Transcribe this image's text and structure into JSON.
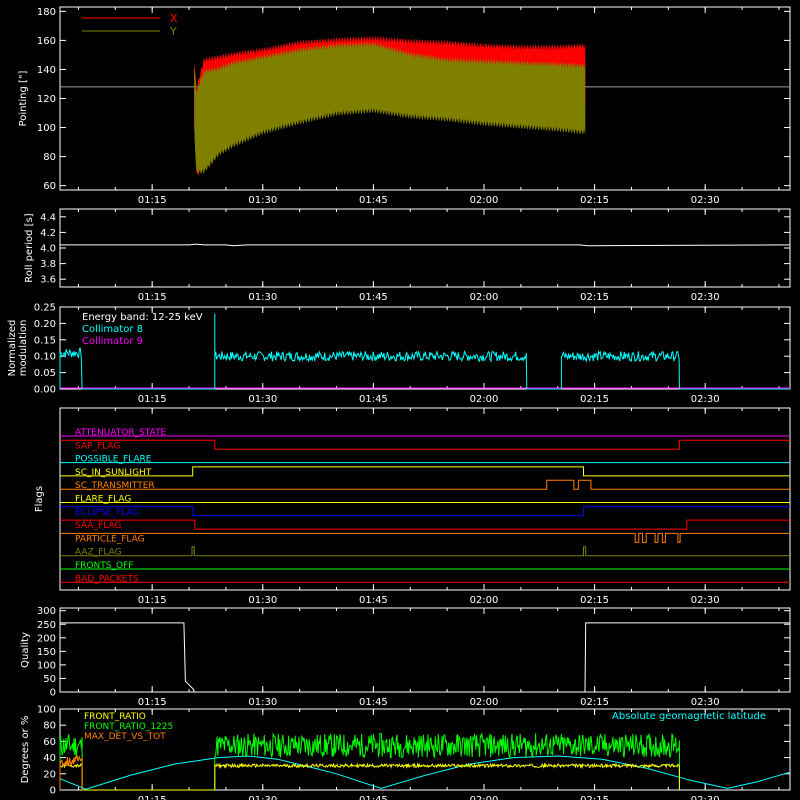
{
  "colors": {
    "background": "#000000",
    "axis": "#ffffff",
    "red": "#ff0000",
    "olive": "#808000",
    "cyan": "#00ffff",
    "magenta": "#ff00ff",
    "yellow": "#ffff00",
    "orange": "#ff8000",
    "blue": "#0000ff",
    "green": "#00ff00",
    "white": "#ffffff"
  },
  "time_axis": {
    "range_minutes": [
      62.5,
      161.5
    ],
    "ticks": [
      {
        "minute": 75,
        "label": "01:15"
      },
      {
        "minute": 90,
        "label": "01:30"
      },
      {
        "minute": 105,
        "label": "01:45"
      },
      {
        "minute": 120,
        "label": "02:00"
      },
      {
        "minute": 135,
        "label": "02:15"
      },
      {
        "minute": 150,
        "label": "02:30"
      }
    ]
  },
  "chart_data": [
    {
      "id": "pointing",
      "type": "line",
      "ylabel": "Pointing [\"]",
      "ylim": [
        57,
        183
      ],
      "yticks": [
        60,
        80,
        100,
        120,
        140,
        160,
        180
      ],
      "legend": [
        {
          "label": "X",
          "color": "#ff0000"
        },
        {
          "label": "Y",
          "color": "#808000"
        }
      ],
      "reference_level": 128,
      "data_span_minutes": [
        80.7,
        133.8
      ],
      "series": [
        {
          "name": "X",
          "color": "#ff0000",
          "x": [
            80.7,
            81,
            82,
            84,
            86,
            90,
            95,
            100,
            105,
            110,
            115,
            120,
            125,
            130,
            133.8
          ],
          "upper": [
            148,
            128,
            148,
            150,
            152,
            155,
            160,
            162,
            163,
            161,
            160,
            158,
            157,
            157,
            158
          ],
          "lower": [
            100,
            66,
            70,
            84,
            92,
            102,
            110,
            118,
            116,
            118,
            117,
            116,
            115,
            114,
            113
          ]
        },
        {
          "name": "Y",
          "color": "#808000",
          "x": [
            80.7,
            81,
            82,
            84,
            86,
            90,
            95,
            100,
            105,
            110,
            115,
            120,
            125,
            130,
            133.8
          ],
          "upper": [
            146,
            126,
            140,
            142,
            146,
            150,
            155,
            158,
            159,
            152,
            148,
            147,
            146,
            145,
            144
          ],
          "lower": [
            96,
            68,
            68,
            80,
            86,
            95,
            102,
            108,
            110,
            106,
            104,
            101,
            99,
            97,
            95
          ]
        }
      ]
    },
    {
      "id": "roll_period",
      "type": "line",
      "ylabel": "Roll period [s]",
      "ylim": [
        3.5,
        4.5
      ],
      "yticks": [
        3.6,
        3.8,
        4.0,
        4.2,
        4.4
      ],
      "yticklabels": [
        "3.6",
        "3.8",
        "4.0",
        "4.2",
        "4.4"
      ],
      "series": [
        {
          "name": "",
          "color": "#ffffff",
          "x": [
            62.5,
            80,
            81,
            82,
            85,
            86,
            88,
            133,
            134,
            161.5
          ],
          "y": [
            4.04,
            4.04,
            4.05,
            4.04,
            4.04,
            4.03,
            4.04,
            4.04,
            4.03,
            4.04
          ]
        }
      ]
    },
    {
      "id": "modulation",
      "type": "line",
      "ylabel": "Normalized modulation",
      "ylabel_lines": [
        "Normalized",
        "modulation"
      ],
      "ylim": [
        0,
        0.25
      ],
      "yticks": [
        0,
        0.05,
        0.1,
        0.15,
        0.2,
        0.25
      ],
      "yticklabels": [
        "0.00",
        "0.05",
        "0.10",
        "0.15",
        "0.20",
        "0.25"
      ],
      "legend": [
        {
          "label": "Energy band: 12-25 keV",
          "color": "#ffffff"
        },
        {
          "label": "Collimator 8",
          "color": "#00ffff"
        },
        {
          "label": "Collimator 9",
          "color": "#ff00ff"
        }
      ],
      "series": [
        {
          "name": "Collimator 8",
          "color": "#00ffff",
          "segments": [
            {
              "x0": 62.5,
              "x1": 65.5,
              "level": 0.11
            },
            {
              "x0": 83.5,
              "x1": 125.8,
              "level": 0.1,
              "spike_at_start": 0.23
            },
            {
              "x0": 130.5,
              "x1": 146.5,
              "level": 0.1
            }
          ],
          "baseline": 0.0
        },
        {
          "name": "Collimator 9",
          "color": "#ff00ff",
          "x": [
            62.5,
            161.5
          ],
          "y": [
            0,
            0
          ]
        }
      ]
    },
    {
      "id": "flags",
      "type": "line",
      "ylabel": "Flags",
      "rows": [
        {
          "label": "ATTENUATOR_STATE",
          "color": "#ff00ff",
          "steps": [
            [
              62.5,
              0
            ],
            [
              161.5,
              0
            ]
          ]
        },
        {
          "label": "SAP_FLAG",
          "color": "#ff0000",
          "steps": [
            [
              62.5,
              1
            ],
            [
              83.5,
              1
            ],
            [
              83.5,
              0
            ],
            [
              146.5,
              0
            ],
            [
              146.5,
              1
            ],
            [
              161.5,
              1
            ]
          ]
        },
        {
          "label": "POSSIBLE_FLARE",
          "color": "#00ffff",
          "steps": [
            [
              62.5,
              0
            ],
            [
              161.5,
              0
            ]
          ]
        },
        {
          "label": "SC_IN_SUNLIGHT",
          "color": "#ffff00",
          "steps": [
            [
              62.5,
              0
            ],
            [
              80.5,
              0
            ],
            [
              80.5,
              1
            ],
            [
              133.5,
              1
            ],
            [
              133.5,
              0
            ],
            [
              161.5,
              0
            ]
          ]
        },
        {
          "label": "SC_TRANSMITTER",
          "color": "#ff8000",
          "steps": [
            [
              62.5,
              0
            ],
            [
              128.5,
              0
            ],
            [
              128.5,
              1
            ],
            [
              132.2,
              1
            ],
            [
              132.2,
              0
            ],
            [
              132.8,
              0
            ],
            [
              132.8,
              1
            ],
            [
              134.5,
              1
            ],
            [
              134.5,
              0
            ],
            [
              161.5,
              0
            ]
          ]
        },
        {
          "label": "FLARE_FLAG",
          "color": "#ffff00",
          "steps": [
            [
              62.5,
              0
            ],
            [
              161.5,
              0
            ]
          ]
        },
        {
          "label": "ECLIPSE_FLAG",
          "color": "#0000ff",
          "steps": [
            [
              62.5,
              1
            ],
            [
              80.5,
              1
            ],
            [
              80.5,
              0
            ],
            [
              133.5,
              0
            ],
            [
              133.5,
              1
            ],
            [
              161.5,
              1
            ]
          ]
        },
        {
          "label": "SAA_FLAG",
          "color": "#ff0000",
          "steps": [
            [
              62.5,
              1
            ],
            [
              80.8,
              1
            ],
            [
              80.8,
              0
            ],
            [
              147.5,
              0
            ],
            [
              147.5,
              1
            ],
            [
              161.5,
              1
            ]
          ]
        },
        {
          "label": "PARTICLE_FLAG",
          "color": "#ff8000",
          "steps": [
            [
              62.5,
              1
            ],
            [
              140.5,
              1
            ],
            [
              140.5,
              0
            ],
            [
              141,
              0
            ],
            [
              141,
              1
            ],
            [
              141.5,
              1
            ],
            [
              141.5,
              0
            ],
            [
              142,
              0
            ],
            [
              142,
              1
            ],
            [
              143.2,
              1
            ],
            [
              143.2,
              0
            ],
            [
              143.6,
              0
            ],
            [
              143.6,
              1
            ],
            [
              144.2,
              1
            ],
            [
              144.2,
              0
            ],
            [
              144.6,
              0
            ],
            [
              144.6,
              1
            ],
            [
              146.3,
              1
            ],
            [
              146.3,
              0
            ],
            [
              146.6,
              0
            ],
            [
              146.6,
              1
            ],
            [
              161.5,
              1
            ]
          ]
        },
        {
          "label": "AAZ_FLAG",
          "color": "#808000",
          "steps": [
            [
              62.5,
              0
            ],
            [
              80.4,
              0
            ],
            [
              80.4,
              1
            ],
            [
              80.7,
              1
            ],
            [
              80.7,
              0
            ],
            [
              133.5,
              0
            ],
            [
              133.5,
              1
            ],
            [
              133.8,
              1
            ],
            [
              133.8,
              0
            ],
            [
              161.5,
              0
            ]
          ]
        },
        {
          "label": "FRONTS_OFF",
          "color": "#00ff00",
          "steps": [
            [
              62.5,
              0
            ],
            [
              161.5,
              0
            ]
          ]
        },
        {
          "label": "BAD_PACKETS",
          "color": "#ff0000",
          "steps": [
            [
              62.5,
              0
            ],
            [
              161.5,
              0
            ]
          ]
        }
      ]
    },
    {
      "id": "quality",
      "type": "line",
      "ylabel": "Quality",
      "ylim": [
        0,
        310
      ],
      "yticks": [
        0,
        50,
        100,
        150,
        200,
        250,
        300
      ],
      "series": [
        {
          "name": "",
          "color": "#ffffff",
          "x": [
            62.5,
            79.3,
            79.5,
            80.6,
            80.7,
            133.7,
            133.8,
            161.5
          ],
          "y": [
            255,
            255,
            40,
            10,
            0,
            0,
            255,
            255
          ]
        }
      ]
    },
    {
      "id": "ratios",
      "type": "line",
      "ylabel": "Degrees or %",
      "ylim": [
        0,
        100
      ],
      "yticks": [
        0,
        20,
        40,
        60,
        80,
        100
      ],
      "legend": [
        {
          "label": "FRONT_RATIO",
          "color": "#ffff00"
        },
        {
          "label": "FRONT_RATIO_1225",
          "color": "#00ff00"
        },
        {
          "label": "MAX_DET_VS_TOT",
          "color": "#ff8000"
        }
      ],
      "annotation": {
        "label": "Absolute geomagnetic latitude",
        "color": "#00ffff"
      },
      "series": [
        {
          "name": "Absolute geomagnetic latitude",
          "color": "#00ffff",
          "x": [
            62.5,
            66,
            72,
            78,
            84,
            88,
            92,
            97,
            100,
            106,
            112,
            118,
            124,
            130,
            136,
            142,
            148,
            153,
            157,
            161.5
          ],
          "y": [
            14,
            1,
            18,
            32,
            40,
            42,
            38,
            27,
            20,
            2,
            18,
            32,
            40,
            42,
            38,
            27,
            12,
            2,
            10,
            22
          ]
        },
        {
          "name": "FRONT_RATIO",
          "color": "#ffff00",
          "segments": [
            {
              "x0": 62.5,
              "x1": 65.5,
              "level": 30
            },
            {
              "x0": 83.5,
              "x1": 146.5,
              "level": 30
            }
          ]
        },
        {
          "name": "FRONT_RATIO_1225",
          "color": "#00ff00",
          "segments": [
            {
              "x0": 62.5,
              "x1": 65.5,
              "level": 55
            },
            {
              "x0": 83.5,
              "x1": 146.5,
              "level": 55
            }
          ]
        },
        {
          "name": "MAX_DET_VS_TOT",
          "color": "#ff8000",
          "segments": [
            {
              "x0": 62.5,
              "x1": 65.5,
              "level": 36
            }
          ]
        }
      ]
    }
  ]
}
